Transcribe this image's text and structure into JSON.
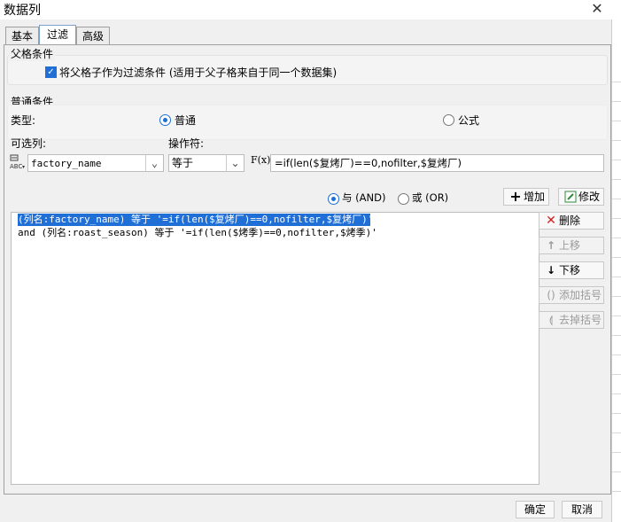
{
  "window": {
    "title": "数据列",
    "close": "✕"
  },
  "tabs": [
    {
      "label": "基本"
    },
    {
      "label": "过滤"
    },
    {
      "label": "高级"
    }
  ],
  "parent_condition": {
    "title": "父格条件",
    "checkbox_label": "将父格子作为过滤条件 (适用于父子格来自于同一个数据集)",
    "checked": true
  },
  "normal_condition": {
    "title": "普通条件",
    "type_label": "类型:",
    "type_options": [
      "普通",
      "公式"
    ],
    "type_selected": "普通",
    "column_label": "可选列:",
    "operator_label": "操作符:",
    "column_value": "factory_name",
    "operator_value": "等于",
    "formula_icon": "F(x)",
    "formula_value": "=if(len($复烤厂)==0,nofilter,$复烤厂)"
  },
  "logic": {
    "and_label": "与 (AND)",
    "or_label": "或 (OR)",
    "selected": "and"
  },
  "buttons": {
    "add": "增加",
    "modify": "修改",
    "delete": "删除",
    "move_up": "上移",
    "move_down": "下移",
    "add_bracket": "添加括号",
    "remove_bracket": "去掉括号"
  },
  "conditions": [
    {
      "text": "(列名:factory_name) 等于 '=if(len($复烤厂)==0,nofilter,$复烤厂)'",
      "selected": true
    },
    {
      "text": "and (列名:roast_season) 等于 '=if(len($烤季)==0,nofilter,$烤季)'",
      "selected": false
    }
  ],
  "footer": {
    "ok": "确定",
    "cancel": "取消"
  },
  "colors": {
    "accent": "#1f6fd6",
    "delete": "#d42020",
    "modify": "#2f8a3a"
  }
}
